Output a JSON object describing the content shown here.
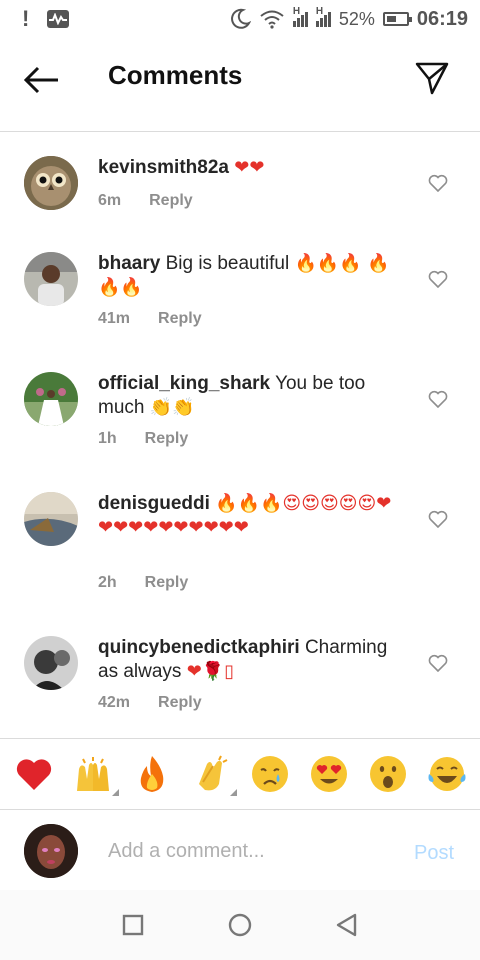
{
  "status_bar": {
    "signal_1": "H",
    "signal_2": "H",
    "battery_pct": "52%",
    "battery_level": 0.52,
    "time": "06:19"
  },
  "header": {
    "title": "Comments",
    "back_icon": "arrow-left-icon",
    "send_icon": "paper-plane-icon"
  },
  "comments": [
    {
      "username": "kevinsmith82a",
      "text": "",
      "emojis": "❤❤",
      "time": "6m",
      "reply": "Reply"
    },
    {
      "username": "bhaary",
      "text": "Big is beautiful",
      "emojis": "🔥🔥🔥 🔥🔥🔥",
      "time": "41m",
      "reply": "Reply"
    },
    {
      "username": "official_king_shark",
      "text": "You be too much",
      "emojis": "👏👏",
      "time": "1h",
      "reply": "Reply"
    },
    {
      "username": "denisgueddi",
      "text": "",
      "emojis": "🔥🔥🔥😍😍😍😍😍❤❤❤❤❤❤❤❤❤❤❤",
      "time": "2h",
      "reply": "Reply"
    },
    {
      "username": "quincybenedictkaphiri",
      "text": "Charming as always",
      "emojis": "❤🌹▯",
      "time": "42m",
      "reply": "Reply"
    }
  ],
  "quick_emojis": [
    {
      "name": "red-heart",
      "glyph": "❤"
    },
    {
      "name": "raising-hands",
      "glyph": "🙌"
    },
    {
      "name": "fire",
      "glyph": "🔥"
    },
    {
      "name": "clapping-hands",
      "glyph": "👏"
    },
    {
      "name": "crying-face",
      "glyph": "😢"
    },
    {
      "name": "heart-eyes",
      "glyph": "😍"
    },
    {
      "name": "surprised-face",
      "glyph": "😮"
    },
    {
      "name": "tears-of-joy",
      "glyph": "😂"
    }
  ],
  "composer": {
    "placeholder": "Add a comment...",
    "post_label": "Post"
  },
  "colors": {
    "heart_red": "#e4322b",
    "post_disabled": "#b3dbff",
    "meta_gray": "#8e8e8e"
  }
}
